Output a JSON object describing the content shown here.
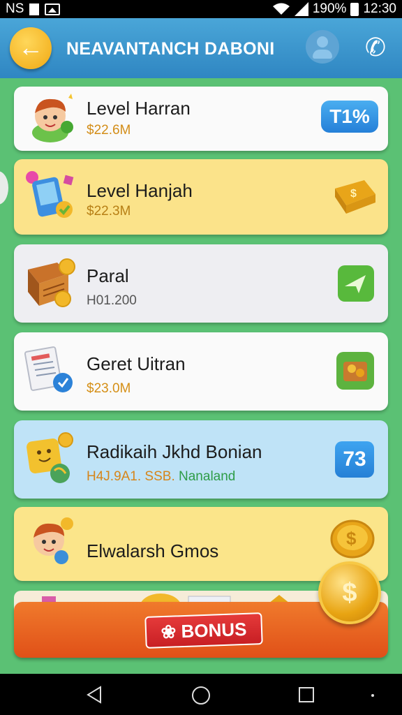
{
  "status_bar": {
    "left_text": "NS",
    "battery_percent": "190%",
    "time": "12:30"
  },
  "header": {
    "title": "NEAVANTANCH DABONI",
    "back_icon": "arrow-left-icon",
    "avatar_icon": "user-avatar-icon",
    "call_icon": "phone-icon"
  },
  "items": [
    {
      "title": "Level Harran",
      "subtitle": "$22.6M",
      "badge": "T1%"
    },
    {
      "title": "Level Hanjah",
      "subtitle": "$22.3M",
      "badge_icon": "money-stack-icon"
    },
    {
      "title": "Paral",
      "subtitle": "H01.200",
      "badge_icon": "plane-icon"
    },
    {
      "title": "Geret Uitran",
      "subtitle": "$23.0M",
      "badge_icon": "treasure-icon"
    },
    {
      "title": "Radikaih Jkhd Bonian",
      "subtitle_part1": "H4J.9A1. SSB.",
      "subtitle_part2": "Nanaland",
      "badge": "73"
    },
    {
      "title": "Elwalarsh Gmos",
      "badge_icon": "coin-icon"
    }
  ],
  "bonus": {
    "label": "BONUS",
    "coin_text": "$"
  },
  "colors": {
    "app_bar": "#3b95cc",
    "background": "#5bc174",
    "accent_gold": "#f0a812",
    "bonus_bar": "#e8611f",
    "badge_blue": "#2a8fe0"
  }
}
